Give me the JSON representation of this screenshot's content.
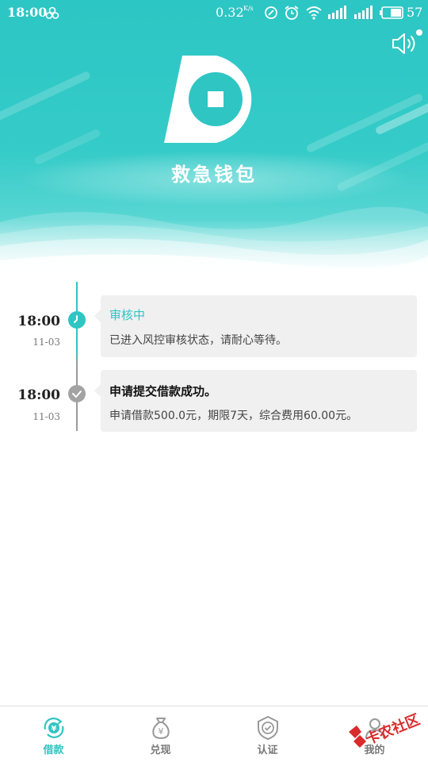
{
  "status_bar": {
    "time": "18:00",
    "network_speed": "0.32",
    "network_speed_unit": "K/s",
    "battery_level": "57",
    "icons": [
      "wind-icon",
      "nfc-icon",
      "alarm-icon",
      "wifi-icon",
      "signal-icon",
      "signal-icon",
      "battery-icon"
    ]
  },
  "header": {
    "brand_name": "救急钱包",
    "icons": [
      "sound-icon",
      "logo-icon"
    ],
    "accent_color": "#2fc5c3"
  },
  "timeline": {
    "items": [
      {
        "time": "18:00",
        "date": "11-03",
        "title": "审核中",
        "description": "已进入风控审核状态，请耐心等待。",
        "status": "in-progress",
        "node_color": "#2fc5c3",
        "icon": "clock-icon"
      },
      {
        "time": "18:00",
        "date": "11-03",
        "title": "申请提交借款成功。",
        "description": "申请借款500.0元，期限7天，综合费用60.00元。",
        "status": "done",
        "node_color": "#a3a3a3",
        "icon": "check-icon"
      }
    ]
  },
  "bottom_nav": {
    "items": [
      {
        "label": "借款",
        "icon": "loan-icon",
        "active": true
      },
      {
        "label": "兑现",
        "icon": "money-bag-icon",
        "active": false
      },
      {
        "label": "认证",
        "icon": "shield-check-icon",
        "active": false
      },
      {
        "label": "我的",
        "icon": "user-icon",
        "active": false
      }
    ]
  },
  "watermark": {
    "text": "卡农社区"
  }
}
